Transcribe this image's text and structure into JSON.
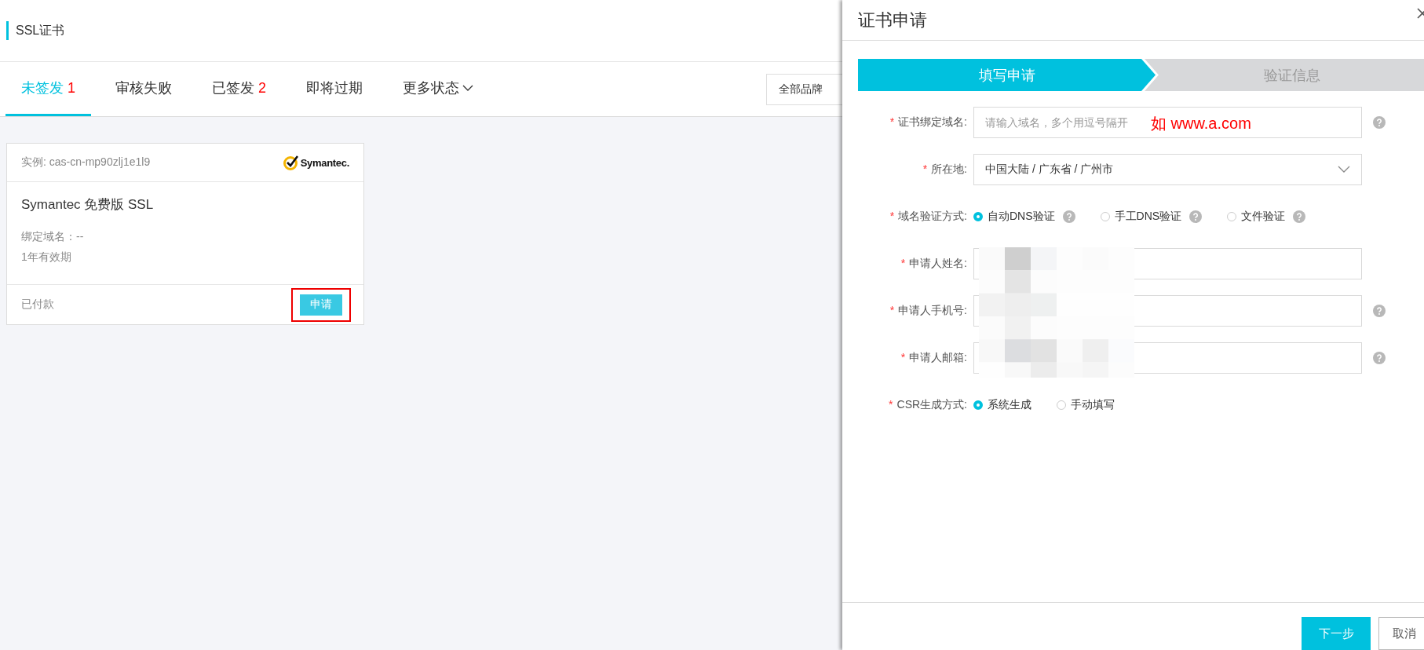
{
  "page": {
    "title": "SSL证书"
  },
  "tabs": [
    {
      "label": "未签发",
      "count": "1",
      "selected": true
    },
    {
      "label": "审核失败",
      "selected": false
    },
    {
      "label": "已签发",
      "count": "2",
      "selected": false
    },
    {
      "label": "即将过期",
      "selected": false
    },
    {
      "label": "更多状态",
      "kind": "dropdown",
      "selected": false
    }
  ],
  "brand_filter": {
    "label": "全部品牌"
  },
  "cards": [
    {
      "instance": "实例: cas-cn-mp90zlj1e1l9",
      "brand_logo": "Symantec.",
      "product": "Symantec 免费版 SSL",
      "domain": "绑定域名：--",
      "validity": "1年有效期",
      "payment_status": "已付款",
      "action": "申请",
      "highlighted": true
    }
  ],
  "drawer": {
    "title": "证书申请",
    "steps": [
      {
        "label": "填写申请",
        "selected": true
      },
      {
        "label": "验证信息",
        "selected": false
      }
    ],
    "fields": [
      {
        "kind": "text",
        "label": "证书绑定域名:",
        "required_mark": "*",
        "placeholder": "请输入域名，多个用逗号隔开",
        "annotation": "如 www.a.com",
        "help": true
      },
      {
        "kind": "select",
        "label": "所在地:",
        "required_mark": "*",
        "value": "中国大陆 / 广东省 / 广州市",
        "help": false
      },
      {
        "kind": "radio",
        "label": "域名验证方式:",
        "required_mark": "*",
        "options": [
          {
            "label": "自动DNS验证",
            "selected": true,
            "help": true
          },
          {
            "label": "手工DNS验证",
            "selected": false,
            "help": true
          },
          {
            "label": "文件验证",
            "selected": false,
            "help": true
          }
        ]
      },
      {
        "kind": "text",
        "label": "申请人姓名:",
        "required_mark": "*",
        "help": false
      },
      {
        "kind": "text",
        "label": "申请人手机号:",
        "required_mark": "*",
        "help": true
      },
      {
        "kind": "text",
        "label": "申请人邮箱:",
        "required_mark": "*",
        "help": true
      },
      {
        "kind": "radio",
        "label": "CSR生成方式:",
        "required_mark": "*",
        "options": [
          {
            "label": "系统生成",
            "selected": true,
            "help": false
          },
          {
            "label": "手动填写",
            "selected": false,
            "help": false
          }
        ]
      }
    ],
    "redacted": true,
    "buttons": [
      {
        "label": "下一步",
        "kind": "primary"
      },
      {
        "label": "取消",
        "kind": "secondary"
      }
    ]
  }
}
